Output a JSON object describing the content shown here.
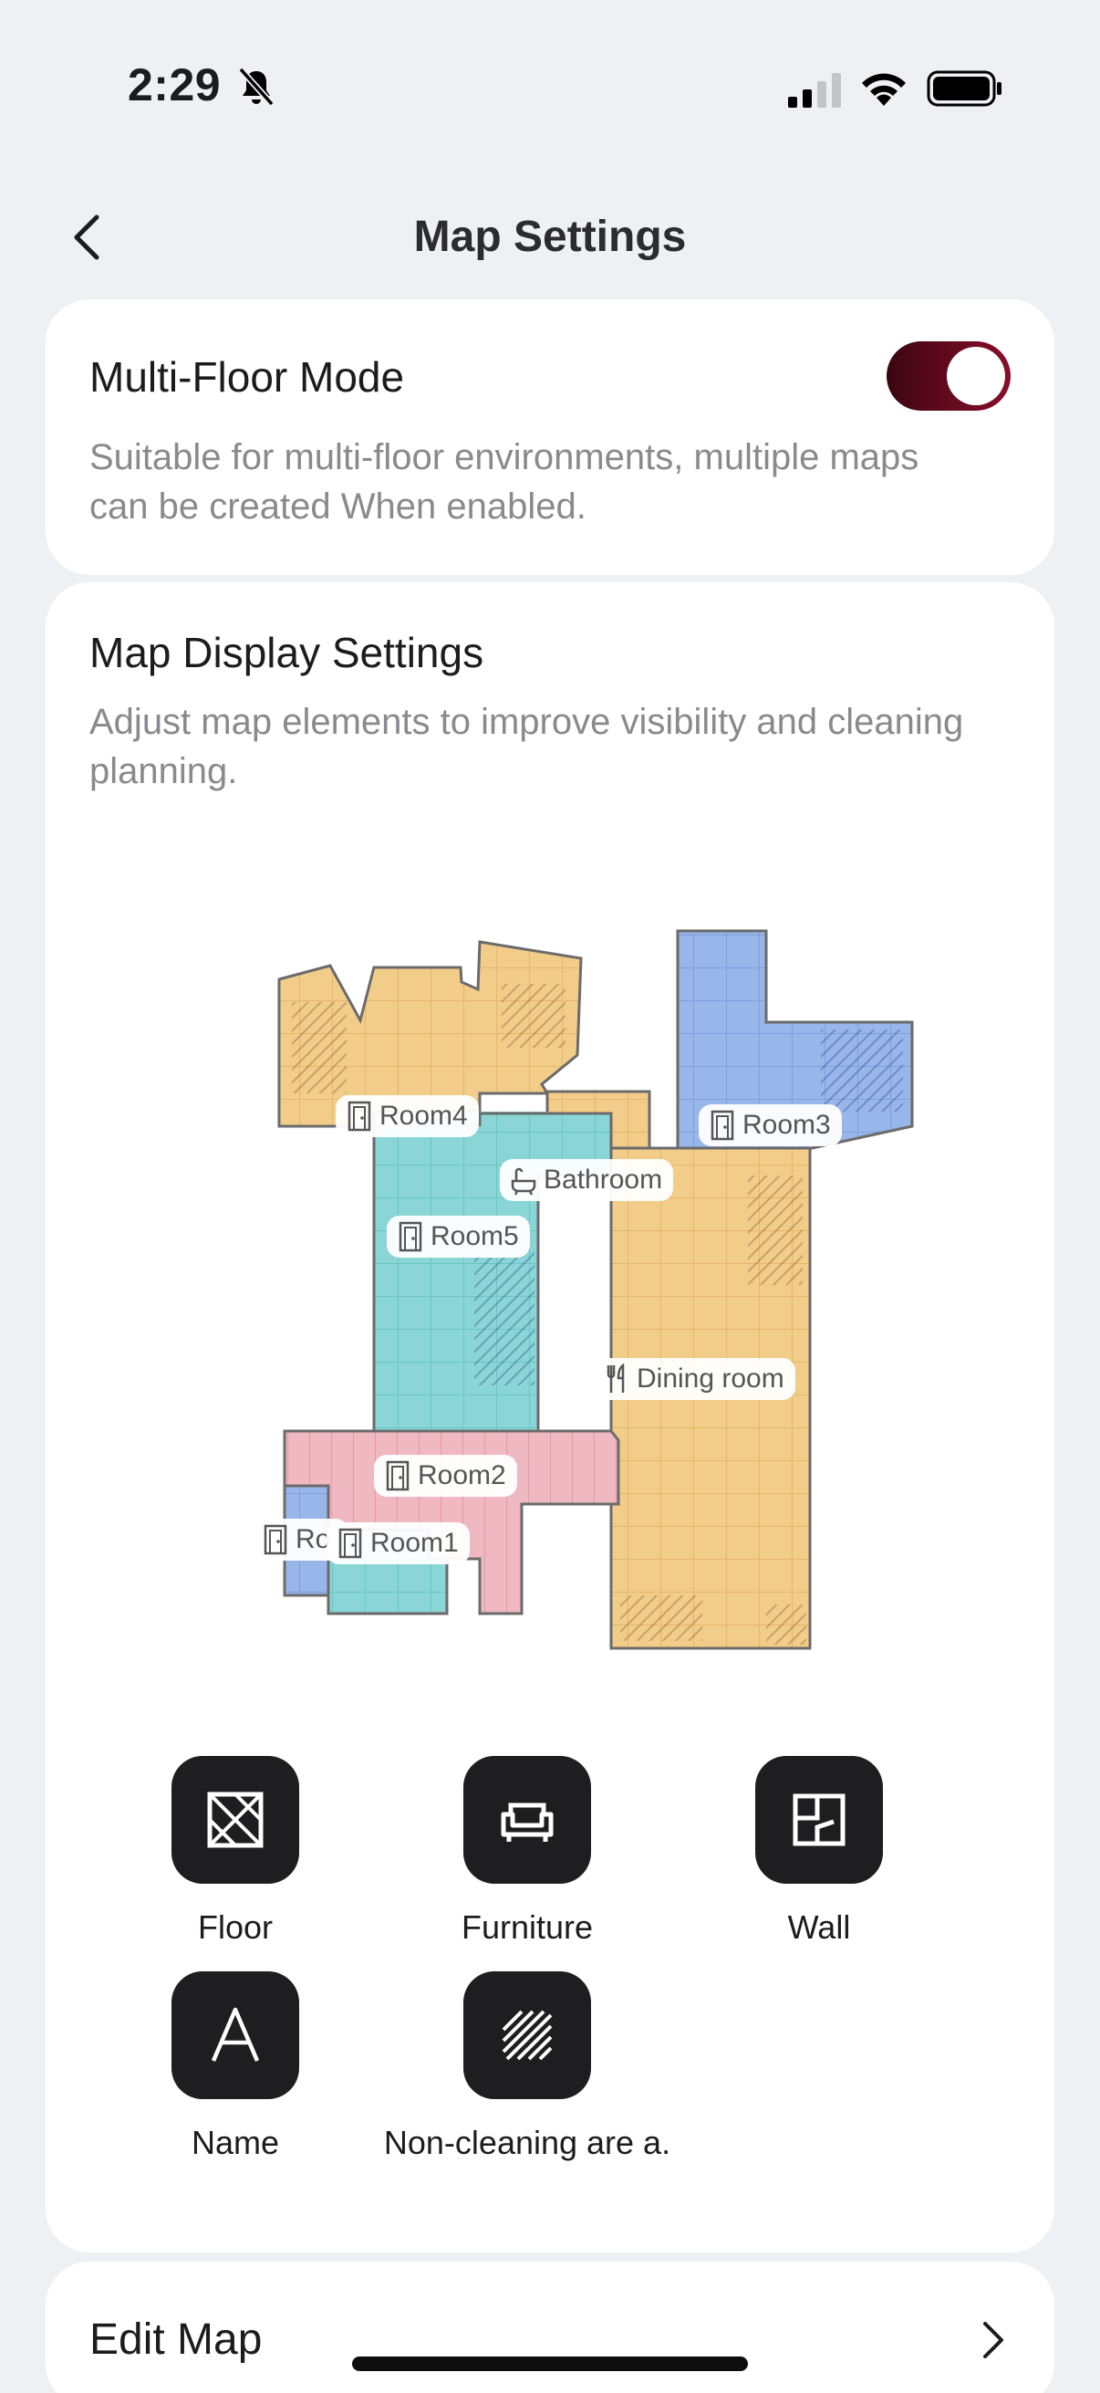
{
  "status_bar": {
    "time": "2:29"
  },
  "nav": {
    "title": "Map Settings"
  },
  "multi_floor": {
    "title": "Multi-Floor Mode",
    "description": "Suitable for multi-floor environments, multiple maps can be created When enabled.",
    "enabled": true
  },
  "map_display": {
    "title": "Map Display Settings",
    "description": "Adjust map elements to improve visibility and cleaning planning.",
    "rooms": [
      {
        "name": "Room4",
        "icon": "door-icon"
      },
      {
        "name": "Room3",
        "icon": "door-icon"
      },
      {
        "name": "Bathroom",
        "icon": "bathtub-icon"
      },
      {
        "name": "Room5",
        "icon": "door-icon"
      },
      {
        "name": "Dining room",
        "icon": "utensils-icon"
      },
      {
        "name": "Room2",
        "icon": "door-icon"
      },
      {
        "name": "Room1",
        "icon": "door-icon"
      },
      {
        "name": "Ro",
        "icon": "door-icon"
      }
    ],
    "tools": [
      {
        "label": "Floor",
        "icon": "floor-icon"
      },
      {
        "label": "Furniture",
        "icon": "sofa-icon"
      },
      {
        "label": "Wall",
        "icon": "wall-icon"
      },
      {
        "label": "Name",
        "icon": "letter-a-icon"
      },
      {
        "label": "Non-cleaning are a.",
        "icon": "hatched-area-icon"
      }
    ],
    "colors": {
      "orange_room": "#f2cd8a",
      "blue_room": "#99b6ea",
      "teal_room": "#8ad6d6",
      "pink_room": "#f0b8c0",
      "outline": "#6b6b6b"
    }
  },
  "edit_map": {
    "title": "Edit Map"
  },
  "accent": {
    "toggle_dark": "#3a0612",
    "toggle_light": "#8a0d2a"
  }
}
